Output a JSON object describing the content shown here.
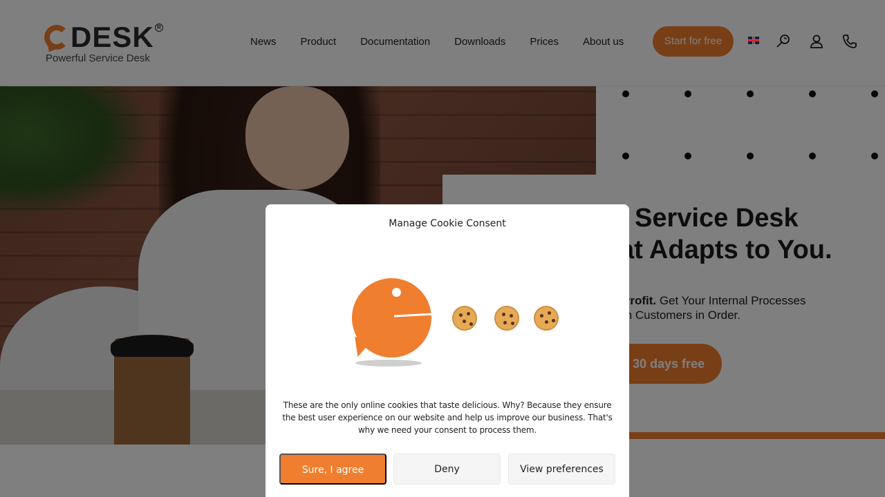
{
  "header": {
    "logo_word": "DESK",
    "logo_reg": "R",
    "logo_tagline": "Powerful Service Desk",
    "nav": [
      "News",
      "Product",
      "Documentation",
      "Downloads",
      "Prices",
      "About us"
    ],
    "cta_label": "Start for free",
    "icons": [
      "uk-flag-icon",
      "search-icon",
      "user-icon",
      "phone-icon"
    ]
  },
  "hero": {
    "title_line1": "Service Desk",
    "title_line2": "at Adapts to You.",
    "sub_bold": "Profit.",
    "sub_line1_rest": " Get Your Internal Processes",
    "sub_line2": "th Customers in Order.",
    "button_label": "30 days free"
  },
  "cookie_modal": {
    "title": "Manage Cookie Consent",
    "text": "These are the only online cookies that taste delicious. Why? Because they ensure the best user experience on our website and help us improve our business. That's why we need your consent to process them.",
    "agree_label": "Sure, I agree",
    "deny_label": "Deny",
    "preferences_label": "View preferences"
  },
  "colors": {
    "accent": "#f07e2f",
    "text": "#1a1a1a",
    "overlay": "rgba(0,0,0,0.5)"
  }
}
